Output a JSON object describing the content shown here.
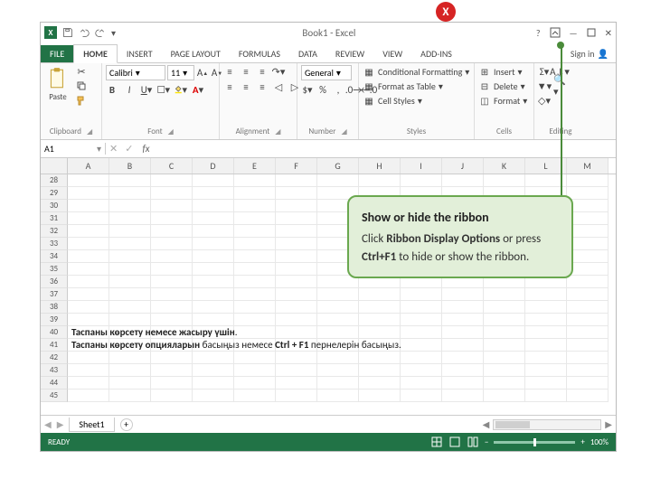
{
  "titlebar": {
    "title": "Book1 - Excel"
  },
  "tabs": [
    "FILE",
    "HOME",
    "INSERT",
    "PAGE LAYOUT",
    "FORMULAS",
    "DATA",
    "REVIEW",
    "VIEW",
    "ADD-INS"
  ],
  "active_tab": "HOME",
  "signin": "Sign in",
  "ribbon": {
    "clipboard": {
      "label": "Clipboard",
      "paste": "Paste"
    },
    "font": {
      "label": "Font",
      "name": "Calibri",
      "size": "11"
    },
    "alignment": {
      "label": "Alignment"
    },
    "number": {
      "label": "Number",
      "format": "General"
    },
    "styles": {
      "label": "Styles",
      "cond": "Conditional Formatting",
      "table": "Format as Table",
      "cell": "Cell Styles"
    },
    "cells": {
      "label": "Cells",
      "insert": "Insert",
      "delete": "Delete",
      "format": "Format"
    },
    "editing": {
      "label": "Editing"
    }
  },
  "namebox": "A1",
  "columns": [
    "A",
    "B",
    "C",
    "D",
    "E",
    "F",
    "G",
    "H",
    "I",
    "J",
    "K",
    "L",
    "M"
  ],
  "row_start": 28,
  "row_end": 45,
  "overlay": {
    "line1_a": "Таспаны көрсету немесе жасыру үшін",
    "line1_b": ".",
    "line2_a": "Таспаны көрсету опцияларын",
    "line2_b": " басыңыз немесе ",
    "line2_c": "Ctrl + F1",
    "line2_d": " пернелерін басыңыз."
  },
  "sheet": {
    "name": "Sheet1",
    "add": "+"
  },
  "status": {
    "ready": "READY",
    "zoom": "100%"
  },
  "callout": {
    "title": "Show or hide the ribbon",
    "click": "Click ",
    "bold": "Ribbon Display Options",
    "rest1": " or press ",
    "bold2": "Ctrl+F1",
    "rest2": " to hide or show the ribbon."
  },
  "badge": "X"
}
